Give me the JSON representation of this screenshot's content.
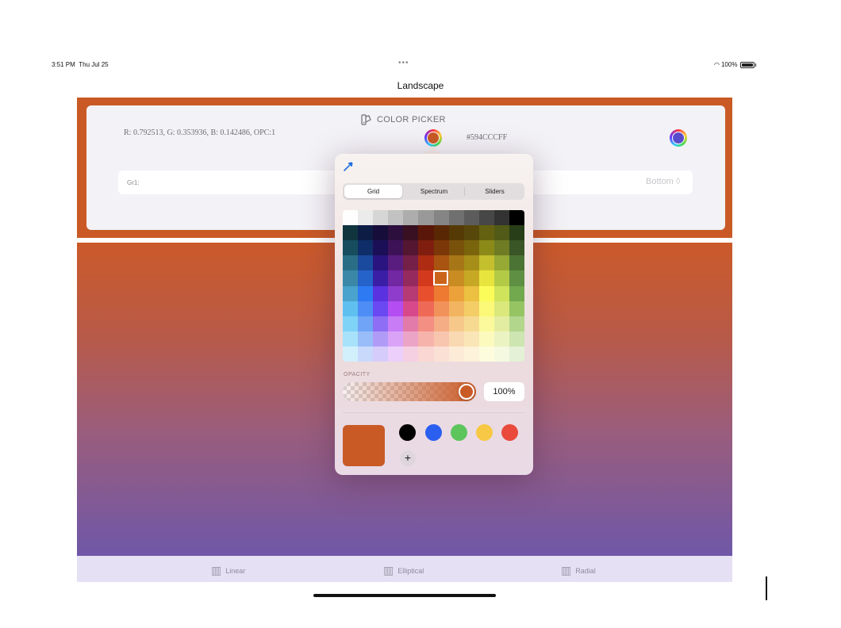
{
  "status_bar": {
    "time": "3:51 PM",
    "date": "Thu Jul 25",
    "dots": "•••",
    "battery": "100%"
  },
  "nav": {
    "title": "Landscape"
  },
  "color_picker_panel": {
    "title": "COLOR PICKER",
    "rgb_text": "R: 0.792513, G: 0.353936, B:  0.142486, OPC:1",
    "hex_text": "#594CCCFF",
    "well_1_color": "#c95a26",
    "well_2_color": "#594ccc",
    "gr_label": "Gr1:",
    "gr_value": "Bottom ◊"
  },
  "popover": {
    "segments": [
      "Grid",
      "Spectrum",
      "Sliders"
    ],
    "selected_segment": "Grid",
    "opacity_label": "OPACITY",
    "opacity_value": "100%",
    "opacity_fraction": 1.0,
    "current_color": "#c95a26",
    "favorites": [
      "#000000",
      "#2a5ff0",
      "#5ec45c",
      "#f7c844",
      "#e94a3c"
    ],
    "add_label": "+",
    "grid_colors": [
      [
        "#fefefe",
        "#ebebeb",
        "#d6d6d6",
        "#c2c2c2",
        "#adadad",
        "#999999",
        "#858585",
        "#707070",
        "#5c5c5c",
        "#474747",
        "#333333",
        "#000000"
      ],
      [
        "#10353f",
        "#0c1c45",
        "#160d3b",
        "#2c0f3d",
        "#381021",
        "#5a1608",
        "#5a2704",
        "#553a05",
        "#58470a",
        "#646110",
        "#515a16",
        "#283e18"
      ],
      [
        "#174d5e",
        "#0f2e69",
        "#1b0f57",
        "#3e1257",
        "#541631",
        "#7f1e0f",
        "#7b3707",
        "#79510b",
        "#7a650c",
        "#8b8a18",
        "#6f7c24",
        "#3a5526"
      ],
      [
        "#2a6e86",
        "#1a4a9d",
        "#2a1580",
        "#591d7f",
        "#742048",
        "#ad2c12",
        "#a95511",
        "#a77617",
        "#a78e19",
        "#c4c02d",
        "#96a934",
        "#4b7434"
      ],
      [
        "#3a87a8",
        "#2562c9",
        "#3a1ea6",
        "#7227a3",
        "#952a5e",
        "#d33a1d",
        "#cb641b",
        "#c88c22",
        "#c7a824",
        "#e8e43e",
        "#b3ca46",
        "#5f8f42"
      ],
      [
        "#49a3cc",
        "#2e7af3",
        "#5a32e0",
        "#8f3bcc",
        "#b63a74",
        "#e8502d",
        "#ed7a30",
        "#eca13a",
        "#ecc040",
        "#fbfb5a",
        "#cfe45a",
        "#72a84e"
      ],
      [
        "#5fc0f0",
        "#4d8df5",
        "#6a48f2",
        "#b44ef2",
        "#d8498c",
        "#ee6a57",
        "#f2925b",
        "#f2b460",
        "#f4cd67",
        "#fbf977",
        "#dbe87c",
        "#96c463"
      ],
      [
        "#7fd3f7",
        "#6fa4f6",
        "#8d6ef4",
        "#c87cf5",
        "#e27aaa",
        "#f38f83",
        "#f5ad86",
        "#f6c98b",
        "#f7da91",
        "#fbf99b",
        "#e3eda1",
        "#b2d68c"
      ],
      [
        "#a7e2fa",
        "#98bdf8",
        "#b09cf7",
        "#daa3f8",
        "#eca4c6",
        "#f6b3ab",
        "#f8c6ae",
        "#f9d9b2",
        "#fae5b6",
        "#fcfabd",
        "#ecf3c2",
        "#cce5b1"
      ],
      [
        "#d2f0fc",
        "#c9d9fb",
        "#d6ccfb",
        "#ecd0fb",
        "#f5d0e3",
        "#fad7d3",
        "#fbe1d5",
        "#fcebd7",
        "#fdf2da",
        "#fdfcdd",
        "#f5f9e0",
        "#e4f1d6"
      ]
    ]
  },
  "tabs": [
    "Linear",
    "Elliptical",
    "Radial"
  ]
}
